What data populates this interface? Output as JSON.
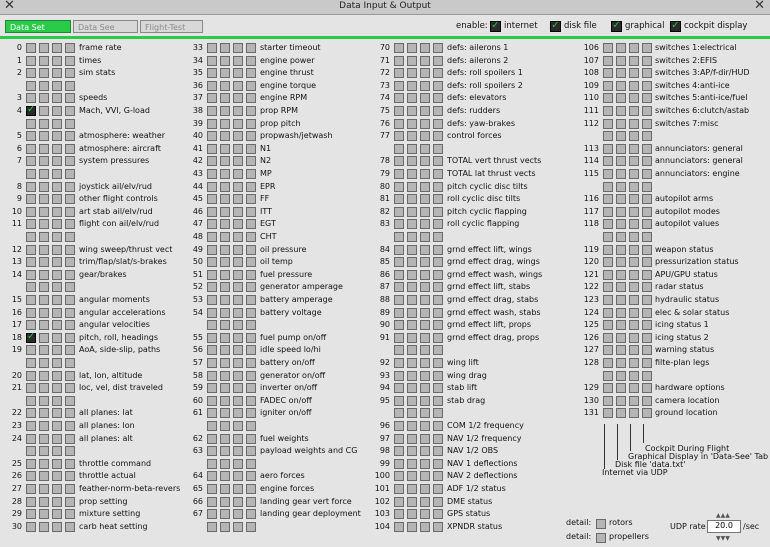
{
  "window": {
    "title": "Data Input & Output"
  },
  "tabs": [
    {
      "label": "Data Set",
      "active": true
    },
    {
      "label": "Data See",
      "active": false
    },
    {
      "label": "Flight-Test",
      "active": false
    }
  ],
  "enable": {
    "label": "enable:",
    "options": [
      {
        "label": "internet",
        "checked": true
      },
      {
        "label": "disk file",
        "checked": true
      },
      {
        "label": "graphical",
        "checked": true
      },
      {
        "label": "cockpit display",
        "checked": true
      }
    ]
  },
  "columns": [
    [
      {
        "num": "0",
        "label": "frame rate"
      },
      {
        "num": "1",
        "label": "times"
      },
      {
        "num": "2",
        "label": "sim stats"
      },
      {
        "num": "",
        "label": ""
      },
      {
        "num": "3",
        "label": "speeds"
      },
      {
        "num": "4",
        "label": "Mach, VVI, G-load",
        "checked": true
      },
      {
        "num": "",
        "label": ""
      },
      {
        "num": "5",
        "label": "atmosphere: weather"
      },
      {
        "num": "6",
        "label": "atmosphere: aircraft"
      },
      {
        "num": "7",
        "label": "system pressures"
      },
      {
        "num": "",
        "label": ""
      },
      {
        "num": "8",
        "label": "joystick ail/elv/rud"
      },
      {
        "num": "9",
        "label": "other flight controls"
      },
      {
        "num": "10",
        "label": "art stab   ail/elv/rud"
      },
      {
        "num": "11",
        "label": "flight con ail/elv/rud"
      },
      {
        "num": "",
        "label": ""
      },
      {
        "num": "12",
        "label": "wing sweep/thrust vect"
      },
      {
        "num": "13",
        "label": "trim/flap/slat/s-brakes"
      },
      {
        "num": "14",
        "label": "gear/brakes"
      },
      {
        "num": "",
        "label": ""
      },
      {
        "num": "15",
        "label": "angular moments"
      },
      {
        "num": "16",
        "label": "angular accelerations"
      },
      {
        "num": "17",
        "label": "angular velocities"
      },
      {
        "num": "18",
        "label": "pitch, roll, headings",
        "checked": true
      },
      {
        "num": "19",
        "label": "AoA, side-slip, paths"
      },
      {
        "num": "",
        "label": ""
      },
      {
        "num": "20",
        "label": "lat, lon, altitude"
      },
      {
        "num": "21",
        "label": "loc, vel, dist traveled"
      },
      {
        "num": "",
        "label": ""
      },
      {
        "num": "22",
        "label": "all planes: lat"
      },
      {
        "num": "23",
        "label": "all planes: lon"
      },
      {
        "num": "24",
        "label": "all planes: alt"
      },
      {
        "num": "",
        "label": ""
      },
      {
        "num": "25",
        "label": "throttle command"
      },
      {
        "num": "26",
        "label": "throttle actual"
      },
      {
        "num": "27",
        "label": "feather-norm-beta-revers"
      },
      {
        "num": "28",
        "label": "prop setting"
      },
      {
        "num": "29",
        "label": "mixture setting"
      },
      {
        "num": "30",
        "label": "carb heat setting"
      }
    ],
    [
      {
        "num": "33",
        "label": "starter timeout"
      },
      {
        "num": "34",
        "label": "engine power"
      },
      {
        "num": "35",
        "label": "engine thrust"
      },
      {
        "num": "36",
        "label": "engine torque"
      },
      {
        "num": "37",
        "label": "engine RPM"
      },
      {
        "num": "38",
        "label": "prop RPM"
      },
      {
        "num": "39",
        "label": "prop pitch"
      },
      {
        "num": "40",
        "label": "propwash/jetwash"
      },
      {
        "num": "41",
        "label": "N1"
      },
      {
        "num": "42",
        "label": "N2"
      },
      {
        "num": "43",
        "label": "MP"
      },
      {
        "num": "44",
        "label": "EPR"
      },
      {
        "num": "45",
        "label": "FF"
      },
      {
        "num": "46",
        "label": "ITT"
      },
      {
        "num": "47",
        "label": "EGT"
      },
      {
        "num": "48",
        "label": "CHT"
      },
      {
        "num": "49",
        "label": "oil pressure"
      },
      {
        "num": "50",
        "label": "oil temp"
      },
      {
        "num": "51",
        "label": "fuel pressure"
      },
      {
        "num": "52",
        "label": "generator amperage"
      },
      {
        "num": "53",
        "label": "battery amperage"
      },
      {
        "num": "54",
        "label": "battery voltage"
      },
      {
        "num": "",
        "label": ""
      },
      {
        "num": "55",
        "label": "fuel pump on/off"
      },
      {
        "num": "56",
        "label": "idle speed lo/hi"
      },
      {
        "num": "57",
        "label": "battery on/off"
      },
      {
        "num": "58",
        "label": "generator on/off"
      },
      {
        "num": "59",
        "label": "inverter on/off"
      },
      {
        "num": "60",
        "label": "FADEC on/off"
      },
      {
        "num": "61",
        "label": "igniter on/off"
      },
      {
        "num": "",
        "label": ""
      },
      {
        "num": "62",
        "label": "fuel weights"
      },
      {
        "num": "63",
        "label": "payload weights and CG"
      },
      {
        "num": "",
        "label": ""
      },
      {
        "num": "64",
        "label": "aero forces"
      },
      {
        "num": "65",
        "label": "engine forces"
      },
      {
        "num": "66",
        "label": "landing gear vert force"
      },
      {
        "num": "67",
        "label": "landing gear deployment"
      },
      {
        "num": "",
        "label": ""
      }
    ],
    [
      {
        "num": "70",
        "label": "defs: ailerons 1"
      },
      {
        "num": "71",
        "label": "defs: ailerons 2"
      },
      {
        "num": "72",
        "label": "defs: roll spoilers 1"
      },
      {
        "num": "73",
        "label": "defs: roll spoilers 2"
      },
      {
        "num": "74",
        "label": "defs: elevators"
      },
      {
        "num": "75",
        "label": "defs: rudders"
      },
      {
        "num": "76",
        "label": "defs: yaw-brakes"
      },
      {
        "num": "77",
        "label": "control forces"
      },
      {
        "num": "",
        "label": ""
      },
      {
        "num": "78",
        "label": "TOTAL vert thrust vects"
      },
      {
        "num": "79",
        "label": "TOTAL lat  thrust vects"
      },
      {
        "num": "80",
        "label": "pitch cyclic disc tilts"
      },
      {
        "num": "81",
        "label": "roll cyclic disc tilts"
      },
      {
        "num": "82",
        "label": "pitch cyclic flapping"
      },
      {
        "num": "83",
        "label": "roll cyclic flapping"
      },
      {
        "num": "",
        "label": ""
      },
      {
        "num": "84",
        "label": "grnd effect lift, wings"
      },
      {
        "num": "85",
        "label": "grnd effect drag, wings"
      },
      {
        "num": "86",
        "label": "grnd effect wash, wings"
      },
      {
        "num": "87",
        "label": "grnd effect lift, stabs"
      },
      {
        "num": "88",
        "label": "grnd effect drag, stabs"
      },
      {
        "num": "89",
        "label": "grnd effect wash, stabs"
      },
      {
        "num": "90",
        "label": "grnd effect lift, props"
      },
      {
        "num": "91",
        "label": "grnd effect drag, props"
      },
      {
        "num": "",
        "label": ""
      },
      {
        "num": "92",
        "label": "wing lift"
      },
      {
        "num": "93",
        "label": "wing drag"
      },
      {
        "num": "94",
        "label": "stab lift"
      },
      {
        "num": "95",
        "label": "stab drag"
      },
      {
        "num": "",
        "label": ""
      },
      {
        "num": "96",
        "label": "COM 1/2 frequency"
      },
      {
        "num": "97",
        "label": "NAV 1/2 frequency"
      },
      {
        "num": "98",
        "label": "NAV 1/2 OBS"
      },
      {
        "num": "99",
        "label": "NAV 1 deflections"
      },
      {
        "num": "100",
        "label": "NAV 2 deflections"
      },
      {
        "num": "101",
        "label": "ADF 1/2 status"
      },
      {
        "num": "102",
        "label": "DME status"
      },
      {
        "num": "103",
        "label": "GPS status"
      },
      {
        "num": "104",
        "label": "XPNDR status"
      }
    ],
    [
      {
        "num": "106",
        "label": "switches 1:electrical"
      },
      {
        "num": "107",
        "label": "switches 2:EFIS"
      },
      {
        "num": "108",
        "label": "switches 3:AP/f-dir/HUD"
      },
      {
        "num": "109",
        "label": "switches 4:anti-ice"
      },
      {
        "num": "110",
        "label": "switches 5:anti-ice/fuel"
      },
      {
        "num": "111",
        "label": "switches 6:clutch/astab"
      },
      {
        "num": "112",
        "label": "switches 7:misc"
      },
      {
        "num": "",
        "label": ""
      },
      {
        "num": "113",
        "label": "annunciators: general"
      },
      {
        "num": "114",
        "label": "annunciators: general"
      },
      {
        "num": "115",
        "label": "annunciators: engine"
      },
      {
        "num": "",
        "label": ""
      },
      {
        "num": "116",
        "label": "autopilot arms"
      },
      {
        "num": "117",
        "label": "autopilot modes"
      },
      {
        "num": "118",
        "label": "autopilot values"
      },
      {
        "num": "",
        "label": ""
      },
      {
        "num": "119",
        "label": "weapon status"
      },
      {
        "num": "120",
        "label": "pressurization status"
      },
      {
        "num": "121",
        "label": "APU/GPU status"
      },
      {
        "num": "122",
        "label": "radar status"
      },
      {
        "num": "123",
        "label": "hydraulic status"
      },
      {
        "num": "124",
        "label": "elec & solar status"
      },
      {
        "num": "125",
        "label": "icing status 1"
      },
      {
        "num": "126",
        "label": "icing status 2"
      },
      {
        "num": "127",
        "label": "warning status"
      },
      {
        "num": "128",
        "label": "filte-plan legs"
      },
      {
        "num": "",
        "label": ""
      },
      {
        "num": "129",
        "label": "hardware options"
      },
      {
        "num": "130",
        "label": "camera location"
      },
      {
        "num": "131",
        "label": "ground location"
      }
    ]
  ],
  "legend": {
    "cockpit": "Cockpit During Flight",
    "graphical": "Graphical Display in 'Data-See' Tab",
    "disk": "Disk file 'data.txt'",
    "internet": "Internet via UDP"
  },
  "detail": {
    "label": "detail:",
    "rotors": "rotors",
    "propellers": "propellers"
  },
  "udp": {
    "label": "UDP rate",
    "value": "20.0",
    "unit": "/sec"
  }
}
